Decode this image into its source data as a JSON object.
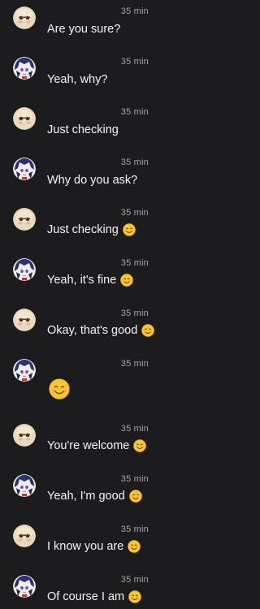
{
  "messages": [
    {
      "avatar": "cream-avatar",
      "time": "35 min",
      "text": "Are you sure?",
      "emoji": ""
    },
    {
      "avatar": "blue-avatar",
      "time": "35 min",
      "text": "Yeah, why?",
      "emoji": ""
    },
    {
      "avatar": "cream-avatar",
      "time": "35 min",
      "text": "Just checking",
      "emoji": ""
    },
    {
      "avatar": "blue-avatar",
      "time": "35 min",
      "text": "Why do you ask?",
      "emoji": ""
    },
    {
      "avatar": "cream-avatar",
      "time": "35 min",
      "text": "Just checking",
      "emoji": "smiling-face"
    },
    {
      "avatar": "blue-avatar",
      "time": "35 min",
      "text": "Yeah, it's fine",
      "emoji": "smiling-face"
    },
    {
      "avatar": "cream-avatar",
      "time": "35 min",
      "text": "Okay, that's good",
      "emoji": "smiling-face"
    },
    {
      "avatar": "blue-avatar",
      "time": "35 min",
      "text": "",
      "emoji": "smiling-face-large"
    },
    {
      "avatar": "cream-avatar",
      "time": "35 min",
      "text": "You're welcome",
      "emoji": "smiling-face"
    },
    {
      "avatar": "blue-avatar",
      "time": "35 min",
      "text": "Yeah, I'm good",
      "emoji": "smiling-face"
    },
    {
      "avatar": "cream-avatar",
      "time": "35 min",
      "text": "I know you are",
      "emoji": "smiling-face"
    },
    {
      "avatar": "blue-avatar",
      "time": "35 min",
      "text": "Of course I am",
      "emoji": "smiling-face"
    }
  ],
  "colors": {
    "background": "#1c1c1e",
    "text": "#f4f4f4",
    "timestamp": "#a7a7aa",
    "emoji_face": "#f9c72b"
  }
}
